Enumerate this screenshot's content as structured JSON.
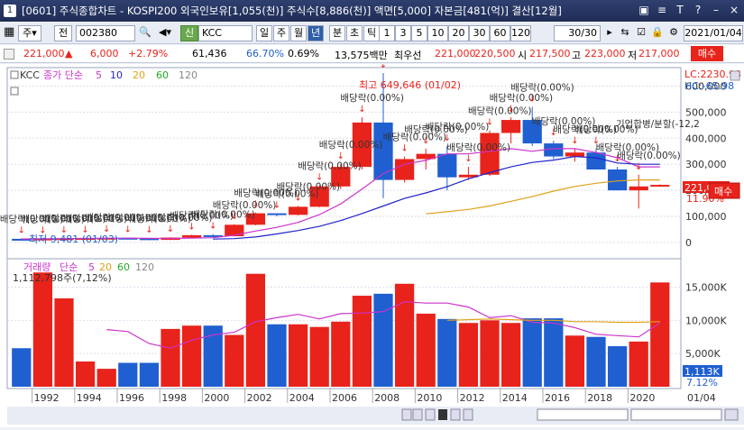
{
  "window": {
    "num": "1",
    "title": "[0601] 주식종합차트 - KOSPI200 외국인보유[1,055(천)] 주식수[8,886(천)] 액면[5,000] 자본금[481(억)] 결산[12월]",
    "buttons": [
      "▣",
      "≡",
      "T",
      "?",
      "–",
      "×"
    ]
  },
  "toolbar": {
    "type_label": "주",
    "prev_label": "전",
    "code": "002380",
    "new_label": "신",
    "name": "KCC",
    "periods": [
      "일",
      "주",
      "월",
      "년",
      "분",
      "초",
      "틱"
    ],
    "active_period": "년",
    "intervals": [
      "1",
      "3",
      "5",
      "10",
      "20",
      "30",
      "60",
      "120"
    ],
    "count": "30/30",
    "date": "2021/01/04"
  },
  "quote": {
    "price": "221,000",
    "arrow": "▲",
    "change": "6,000",
    "pct": "+2.79%",
    "volume": "61,436",
    "vol_ratio": "66.70%",
    "turnover": "0.69%",
    "amount": "13,575백만",
    "ask_label": "최우선",
    "ask": "221,000",
    "bid": "220,500",
    "open_label": "시",
    "open": "217,500",
    "high_label": "고",
    "high": "223,000",
    "low_label": "저",
    "low": "217,000",
    "trade_btn": "매수"
  },
  "colors": {
    "up": "#e8231b",
    "down": "#1f5fd0",
    "ma5": "#cc33cc",
    "ma10": "#2222cc",
    "ma20": "#e0a21a",
    "ma60": "#22aa22",
    "ma120": "#888888"
  },
  "price_panel": {
    "legend_name": "KCC",
    "legend_series": "종가 단순",
    "legend_periods": [
      "5",
      "10",
      "20",
      "60",
      "120"
    ],
    "lc_label": "LC:2230.98",
    "hc_label": "HC:-65.98",
    "max_label": "최고 649,646 (01/02)",
    "min_label": "최저 9,481 (01/03)",
    "cur_price": "221,000",
    "cur_pct": "11.90%",
    "side_btn": "매수",
    "y_ticks": [
      "600,000",
      "500,000",
      "400,000",
      "300,000",
      "200,000",
      "100,000",
      "0"
    ],
    "dividend": "배당락(0.00%)",
    "merger": "기업합병/분할(-12,2"
  },
  "volume_panel": {
    "legend_name": "거래량",
    "legend_series": "단순",
    "legend_periods": [
      "5",
      "20",
      "60",
      "120"
    ],
    "stat": "1,112,798주(7,12%)",
    "y_ticks": [
      "15,000K",
      "10,000K",
      "5,000K"
    ],
    "cur_val": "1,113K",
    "cur_pct": "7.12%"
  },
  "x_axis": {
    "labels": [
      "1992",
      "1994",
      "1996",
      "1998",
      "2000",
      "2002",
      "2004",
      "2006",
      "2008",
      "2010",
      "2012",
      "2014",
      "2016",
      "2018",
      "2020"
    ],
    "end_label": "01/04"
  },
  "chart_data": {
    "type": "bar",
    "years": [
      1991,
      1992,
      1993,
      1994,
      1995,
      1996,
      1997,
      1998,
      1999,
      2000,
      2001,
      2002,
      2003,
      2004,
      2005,
      2006,
      2007,
      2008,
      2009,
      2010,
      2011,
      2012,
      2013,
      2014,
      2015,
      2016,
      2017,
      2018,
      2019,
      2020,
      2021
    ],
    "candles": [
      [
        14000,
        16000,
        12000,
        13000
      ],
      [
        13000,
        16000,
        11000,
        15000
      ],
      [
        15000,
        17000,
        13000,
        16000
      ],
      [
        16000,
        18000,
        15000,
        17000
      ],
      [
        17000,
        20000,
        17000,
        18000
      ],
      [
        18000,
        19000,
        15000,
        16000
      ],
      [
        16000,
        17000,
        9500,
        10000
      ],
      [
        10000,
        20000,
        9481,
        19000
      ],
      [
        19000,
        30000,
        17000,
        28000
      ],
      [
        28000,
        32000,
        20000,
        24000
      ],
      [
        24000,
        70000,
        23000,
        68000
      ],
      [
        68000,
        115000,
        66000,
        112000
      ],
      [
        112000,
        112000,
        100000,
        106000
      ],
      [
        106000,
        140000,
        104000,
        137000
      ],
      [
        137000,
        220000,
        135000,
        215000
      ],
      [
        215000,
        300000,
        205000,
        290000
      ],
      [
        290000,
        480000,
        280000,
        460000
      ],
      [
        460000,
        649646,
        170000,
        240000
      ],
      [
        240000,
        330000,
        230000,
        320000
      ],
      [
        320000,
        360000,
        280000,
        340000
      ],
      [
        340000,
        370000,
        200000,
        250000
      ],
      [
        250000,
        290000,
        240000,
        260000
      ],
      [
        260000,
        430000,
        255000,
        420000
      ],
      [
        420000,
        480000,
        380000,
        470000
      ],
      [
        470000,
        520000,
        370000,
        380000
      ],
      [
        380000,
        390000,
        320000,
        330000
      ],
      [
        330000,
        360000,
        310000,
        345000
      ],
      [
        345000,
        360000,
        280000,
        280000
      ],
      [
        280000,
        290000,
        200000,
        200000
      ],
      [
        200000,
        260000,
        130000,
        215000
      ],
      [
        215000,
        223000,
        217000,
        221000
      ]
    ],
    "ma5": [
      13500,
      14200,
      14800,
      15500,
      16000,
      16500,
      15800,
      15600,
      16800,
      18200,
      28000,
      44000,
      58000,
      77000,
      107000,
      148000,
      205000,
      264000,
      300000,
      315000,
      340000,
      340000,
      350000,
      360000,
      350000,
      360000,
      360000,
      345000,
      325000,
      290000,
      290000
    ],
    "ma20": [
      null,
      null,
      null,
      null,
      null,
      null,
      null,
      null,
      null,
      null,
      null,
      null,
      null,
      null,
      null,
      null,
      null,
      null,
      null,
      110000,
      118000,
      127000,
      140000,
      158000,
      176000,
      197000,
      215000,
      227000,
      236000,
      240000,
      240000
    ],
    "ma10": [
      null,
      null,
      null,
      null,
      null,
      null,
      null,
      null,
      null,
      13000,
      15000,
      21000,
      33000,
      46000,
      62000,
      84000,
      111000,
      140000,
      169000,
      190000,
      214000,
      244000,
      268000,
      290000,
      307000,
      316000,
      330000,
      325000,
      305000,
      300000,
      300000
    ],
    "volume_k": [
      5800,
      17200,
      13300,
      3800,
      2700,
      3600,
      3600,
      8700,
      9200,
      9200,
      7800,
      17000,
      9400,
      9400,
      9000,
      9800,
      13700,
      14000,
      15500,
      11000,
      10200,
      9600,
      10000,
      9600,
      10300,
      10300,
      7700,
      7500,
      6100,
      6800,
      15700,
      1113
    ],
    "vol_ma5": [
      null,
      null,
      null,
      null,
      8600,
      8300,
      6500,
      5800,
      7000,
      7800,
      8200,
      9800,
      10400,
      10900,
      10200,
      11000,
      11100,
      11300,
      12800,
      12600,
      12600,
      12000,
      10400,
      10700,
      9700,
      9600,
      8900,
      7900,
      7700,
      7500,
      9600,
      7000
    ],
    "vol_ma20": [
      null,
      null,
      null,
      null,
      null,
      null,
      null,
      null,
      null,
      null,
      null,
      null,
      null,
      null,
      null,
      null,
      null,
      null,
      null,
      null,
      10000,
      10100,
      10200,
      10100,
      10000,
      10000,
      9800,
      9800,
      9700,
      9700,
      9800,
      9500
    ]
  }
}
